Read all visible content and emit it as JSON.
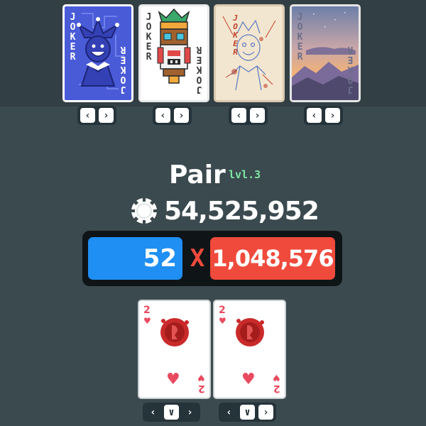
{
  "jokers": [
    {
      "label": "JOKER",
      "style": "blue-jester",
      "controls": [
        "‹",
        "›"
      ]
    },
    {
      "label": "JOKER",
      "style": "tiki-mask",
      "controls": [
        "‹",
        "›"
      ]
    },
    {
      "label": "JOKER",
      "style": "sketch",
      "controls": [
        "‹",
        "›"
      ]
    },
    {
      "label": "JOKER",
      "style": "sunset",
      "controls": [
        "‹",
        "›"
      ]
    }
  ],
  "hand": {
    "name": "Pair",
    "level": "lvl.3",
    "total_chips": "54,525,952",
    "chips": "52",
    "times": "X",
    "mult": "1,048,576"
  },
  "cards": [
    {
      "rank": "2",
      "suit": "hearts",
      "suit_symbol": "♥",
      "seal": "red-wax-seal",
      "controls": [
        "‹",
        "∨",
        "›"
      ]
    },
    {
      "rank": "2",
      "suit": "hearts",
      "suit_symbol": "♥",
      "seal": "red-wax-seal",
      "controls": [
        "‹",
        "∨",
        "›"
      ]
    }
  ],
  "colors": {
    "background": "#3b4a4f",
    "chip_blue": "#1f8ff4",
    "mult_red": "#f04a3c",
    "level_green": "#7ee6a0",
    "heart_red": "#e84a5f"
  }
}
